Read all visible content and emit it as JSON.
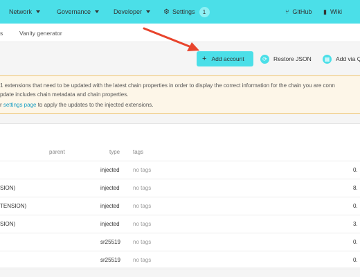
{
  "nav": {
    "network": "Network",
    "governance": "Governance",
    "developer": "Developer",
    "settings": "Settings",
    "settings_badge": "1",
    "github": "GitHub",
    "wiki": "Wiki"
  },
  "subtabs": {
    "accounts_partial": "s",
    "vanity": "Vanity generator"
  },
  "actions": {
    "add_account": "Add account",
    "restore_json": "Restore JSON",
    "add_via": "Add via Q"
  },
  "notice": {
    "line1": "1 extensions that need to be updated with the latest chain properties in order to display the correct information for the chain you are conn",
    "line2": "pdate includes chain metadata and chain properties.",
    "line3_link": "settings page",
    "line3_prefix": "r ",
    "line3_suffix": " to apply the updates to the injected extensions."
  },
  "table": {
    "headers": {
      "parent": "parent",
      "type": "type",
      "tags": "tags"
    },
    "rows": [
      {
        "name": "",
        "type": "injected",
        "tags": "no tags",
        "balance": "0."
      },
      {
        "name": "SION)",
        "type": "injected",
        "tags": "no tags",
        "balance": "8."
      },
      {
        "name": "TENSION)",
        "type": "injected",
        "tags": "no tags",
        "balance": "0."
      },
      {
        "name": "SION)",
        "type": "injected",
        "tags": "no tags",
        "balance": "3."
      },
      {
        "name": "",
        "type": "sr25519",
        "tags": "no tags",
        "balance": "0."
      },
      {
        "name": "",
        "type": "sr25519",
        "tags": "no tags",
        "balance": "0."
      }
    ]
  },
  "colors": {
    "accent": "#4bdfe8",
    "arrow": "#e8442c",
    "notice_bg": "#fdf6e8",
    "notice_border": "#f1c66f",
    "link": "#1a9fc4"
  }
}
